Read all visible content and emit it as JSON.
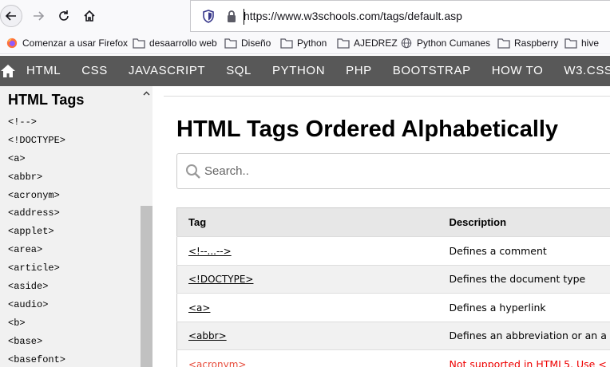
{
  "browser": {
    "url": "https://www.w3schools.com/tags/default.asp"
  },
  "bookmarks": [
    {
      "label": "Comenzar a usar Firefox",
      "icon": "firefox-icon"
    },
    {
      "label": "desaarrollo web",
      "icon": "folder-icon"
    },
    {
      "label": "Diseño",
      "icon": "folder-icon"
    },
    {
      "label": "Python",
      "icon": "folder-icon"
    },
    {
      "label": "AJEDREZ",
      "icon": "folder-icon"
    },
    {
      "label": "Python Cumanes",
      "icon": "globe-icon"
    },
    {
      "label": "Raspberry",
      "icon": "folder-icon"
    },
    {
      "label": "hive",
      "icon": "folder-icon"
    }
  ],
  "w3nav": {
    "items": [
      "HTML",
      "CSS",
      "JAVASCRIPT",
      "SQL",
      "PYTHON",
      "PHP",
      "BOOTSTRAP",
      "HOW TO",
      "W3.CSS"
    ]
  },
  "sidebar": {
    "title": "HTML Tags",
    "items": [
      "<!-->",
      "<!DOCTYPE>",
      "<a>",
      "<abbr>",
      "<acronym>",
      "<address>",
      "<applet>",
      "<area>",
      "<article>",
      "<aside>",
      "<audio>",
      "<b>",
      "<base>",
      "<basefont>"
    ]
  },
  "main": {
    "title": "HTML Tags Ordered Alphabetically",
    "search_placeholder": "Search..",
    "table": {
      "headers": [
        "Tag",
        "Description"
      ],
      "rows": [
        {
          "tag": "<!--...-->",
          "desc": "Defines a comment"
        },
        {
          "tag": "<!DOCTYPE>",
          "desc": "Defines the document type"
        },
        {
          "tag": "<a>",
          "desc": "Defines a hyperlink"
        },
        {
          "tag": "<abbr>",
          "desc": "Defines an abbreviation or an a"
        },
        {
          "tag": "<acronym>",
          "desc": "Not supported in HTML5. Use <"
        }
      ]
    }
  },
  "colors": {
    "nav_bg": "#585858",
    "sidebar_bg": "#f1f1f1",
    "unsupported": "#e74c3c"
  }
}
